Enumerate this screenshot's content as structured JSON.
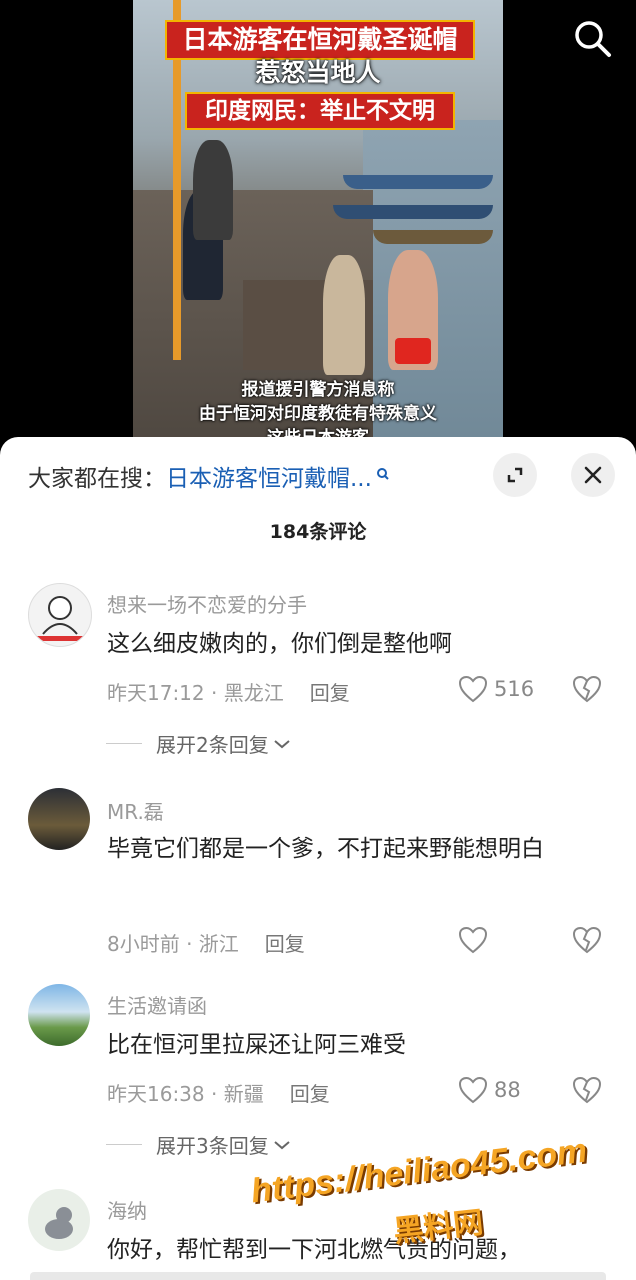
{
  "video": {
    "title_line1": "日本游客在恒河戴圣诞帽",
    "title_line2": "惹怒当地人",
    "title_line3": "印度网民：举止不文明",
    "caption_line1": "报道援引警方消息称",
    "caption_line2": "由于恒河对印度教徒有特殊意义",
    "caption_line3": "这些日本游客"
  },
  "search": {
    "prefix": "大家都在搜：",
    "query": "日本游客恒河戴帽..."
  },
  "comments_header": {
    "count_label": "184条评论"
  },
  "comments": [
    {
      "user": "想来一场不恋爱的分手",
      "text": "这么细皮嫩肉的，你们倒是整他啊",
      "time_location": "昨天17:12 · 黑龙江",
      "reply_label": "回复",
      "likes": "516",
      "expand_label": "展开2条回复"
    },
    {
      "user": "MR.磊",
      "text": "毕竟它们都是一个爹，不打起来野能想明白",
      "time_location": "8小时前 · 浙江",
      "reply_label": "回复",
      "likes": ""
    },
    {
      "user": "生活邀请函",
      "text": "比在恒河里拉屎还让阿三难受",
      "time_location": "昨天16:38 · 新疆",
      "reply_label": "回复",
      "likes": "88",
      "expand_label": "展开3条回复"
    },
    {
      "user": "海纳",
      "text": "你好，帮忙帮到一下河北燃气贵的问题，"
    }
  ],
  "watermark": {
    "url": "https://heiliao45.com",
    "name": "黑料网"
  },
  "colors": {
    "accent_link": "#1a5fb4",
    "title_red": "#c9231e",
    "watermark_orange": "#f5a524"
  }
}
